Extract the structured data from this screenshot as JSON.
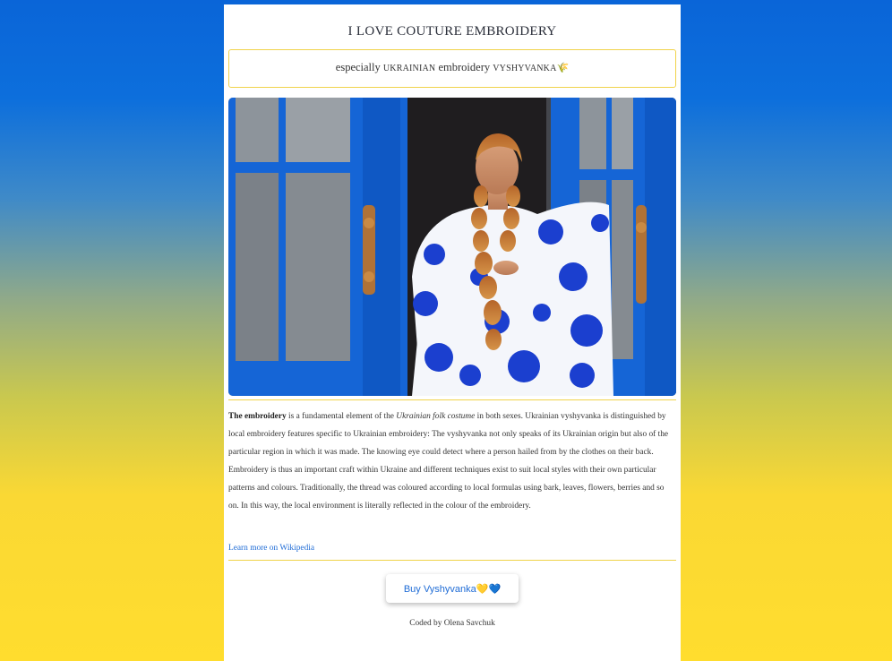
{
  "page": {
    "title": "I LOVE COUTURE EMBROIDERY"
  },
  "subtitle": {
    "word1": "especially",
    "word2": "UKRAINIAN",
    "word3": "embroidery",
    "word4": "VYSHYVANKA",
    "emoji": "🌾"
  },
  "photo": {
    "alt": "Woman in a white and blue embroidered vyshyvanka dress standing in a blue doorway"
  },
  "description": {
    "lead_bold": "The embroidery",
    "part1": " is a fundamental element of the ",
    "italic": "Ukrainian folk costume",
    "part2": " in both sexes. Ukrainian vyshyvanka is distinguished by local embroidery features specific to Ukrainian embroidery: The vyshyvanka not only speaks of its Ukrainian origin but also of the particular region in which it was made. The knowing eye could detect where a person hailed from by the clothes on their back. Embroidery is thus an important craft within Ukraine and different techniques exist to suit local styles with their own particular patterns and colours. Traditionally, the thread was coloured according to local formulas using bark, leaves, flowers, berries and so on. In this way, the local environment is literally reflected in the colour of the embroidery."
  },
  "links": {
    "wikipedia": "Learn more on Wikipedia"
  },
  "buttons": {
    "buy": "Buy Vyshyvanka💛💙"
  },
  "footer": {
    "credit": "Coded by Olena Savchuk"
  },
  "colors": {
    "gradient_top": "#0a65d8",
    "gradient_bottom": "#ffdd2e",
    "accent_border": "#f0d34a",
    "link": "#1f6cd6"
  }
}
